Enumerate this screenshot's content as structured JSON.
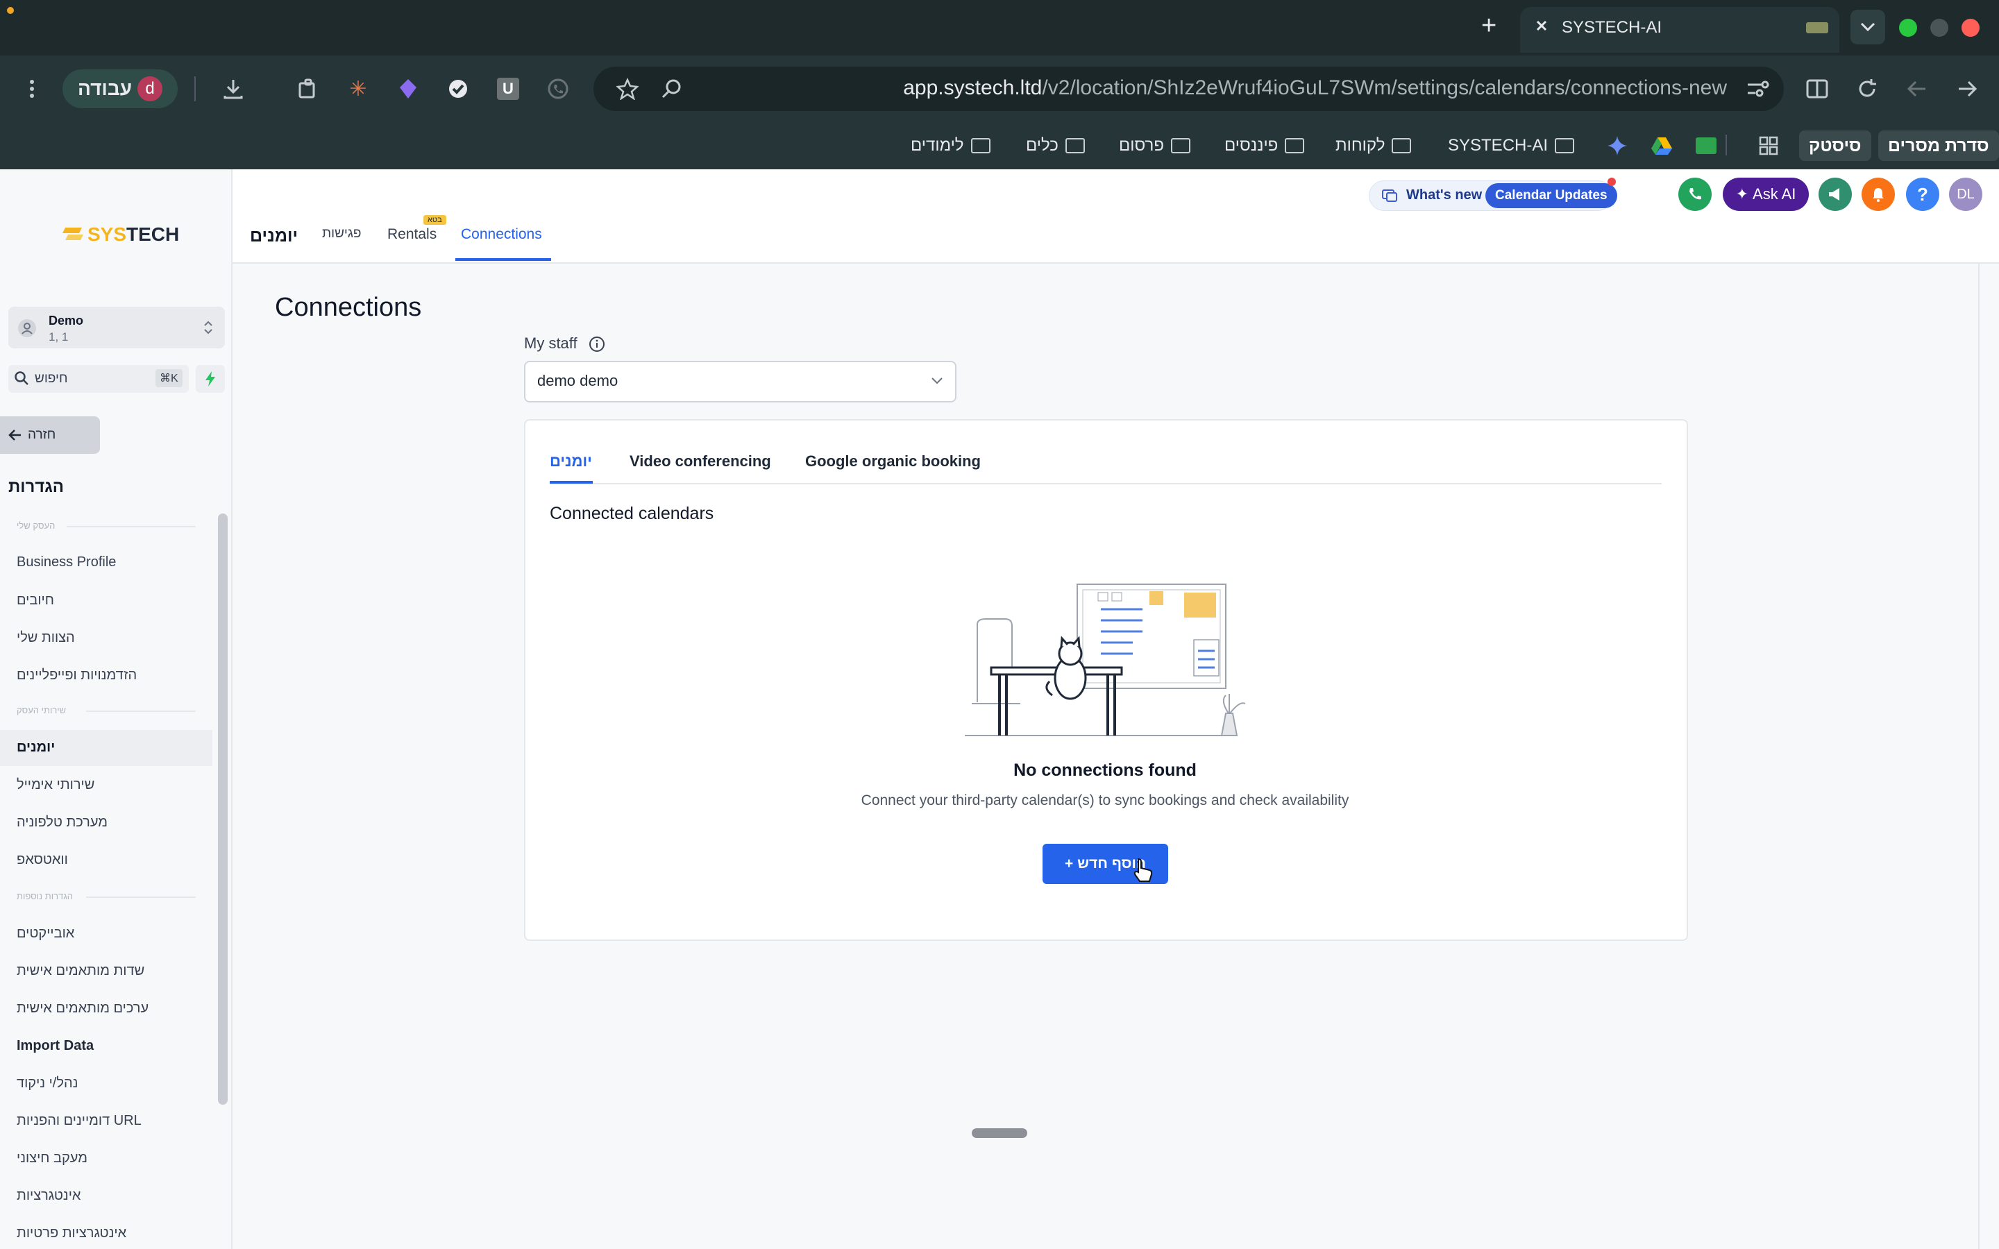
{
  "browser": {
    "tab_title": "SYSTECH-AI",
    "new_tab_label": "+",
    "url_domain": "app.systech.ltd",
    "url_path": "/v2/location/ShIz2eWruf4ioGuL7SWm/settings/calendars/connections-new",
    "profile_label": "עבודה",
    "profile_initial": "d",
    "bookmarks": [
      "סדרת מסרים",
      "סיסטק",
      "SYSTECH-AI",
      "לקוחות",
      "פיננסים",
      "פרסום",
      "כלים",
      "לימודים"
    ],
    "colors": {
      "tabbar": "#1e2a2c",
      "toolbar": "#263638"
    }
  },
  "app": {
    "logo_text_1": "SYS",
    "logo_text_2": "TECH",
    "sub_tabs": [
      "יומנים",
      "פגישות",
      "Rentals",
      "Connections"
    ],
    "rentals_badge": "בטא",
    "whats_new": "What's new",
    "calendar_updates": "Calendar Updates",
    "ask_ai": "Ask AI",
    "help": "?",
    "avatar": "DL",
    "accent": "#2563eb"
  },
  "sidebar": {
    "account_name": "Demo",
    "account_sub": "1, 1",
    "search_placeholder": "חיפוש",
    "search_shortcut": "⌘K",
    "back_label": "חזרה",
    "title": "הגדרות",
    "section1": "העסק שלי",
    "section2": "שירותי העסק",
    "section3": "הגדרות נוספות",
    "items_group1": [
      "Business Profile",
      "חיובים",
      "הצוות שלי",
      "הזדמנויות ופייפליינים"
    ],
    "items_group2": [
      "יומנים",
      "שירותי אימייל",
      "מערכת טלפוניה",
      "וואטסאפ"
    ],
    "items_group3": [
      "אובייקטים",
      "שדות מותאמים אישית",
      "ערכים מותאמים אישית",
      "Import Data",
      "נהל/י ניקוד",
      "דומיינים והפניות URL",
      "מעקב חיצוני",
      "אינטגרציות",
      "אינטגרציות פרטיות"
    ]
  },
  "main": {
    "page_title": "Connections",
    "staff_label": "My staff",
    "staff_value": "demo demo",
    "card_tabs": [
      "יומנים",
      "Video conferencing",
      "Google organic booking"
    ],
    "section_title": "Connected calendars",
    "empty_title": "No connections found",
    "empty_desc": "Connect your third-party calendar(s) to sync bookings and check availability",
    "add_button": "+ הוסף חדש"
  }
}
